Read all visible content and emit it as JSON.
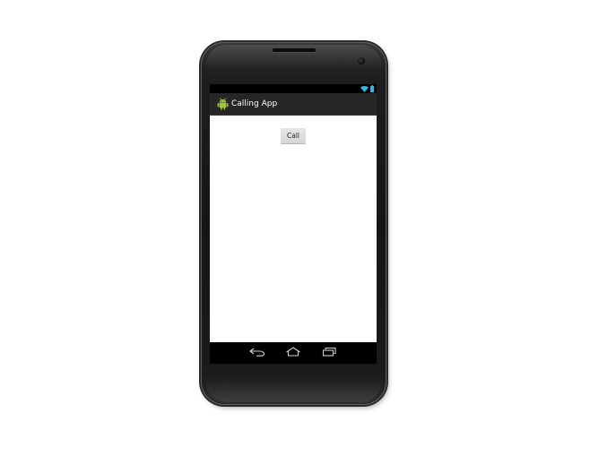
{
  "window": {
    "title": "Calling App"
  },
  "device": {
    "model": "phone-frame"
  },
  "status_bar": {
    "icons": [
      "wifi-icon",
      "battery-icon"
    ],
    "color": "#33b5e5"
  },
  "action_bar": {
    "app_icon": "android-robot-icon",
    "title": "Calling App",
    "background": "#262626"
  },
  "content": {
    "call_button_label": "Call"
  },
  "nav_bar": {
    "buttons": [
      {
        "name": "back-button",
        "icon": "back-arrow-icon"
      },
      {
        "name": "home-button",
        "icon": "home-icon"
      },
      {
        "name": "recents-button",
        "icon": "recent-apps-icon"
      }
    ]
  }
}
